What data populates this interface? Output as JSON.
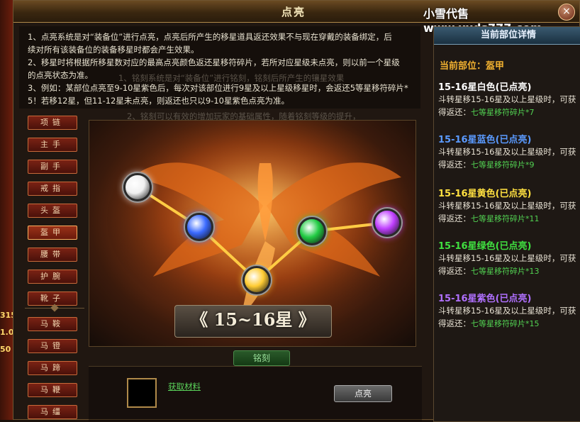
{
  "window": {
    "title": "点亮",
    "watermark": "小雪代售www.xxds777.com",
    "close_glyph": "×"
  },
  "sidebar_numbers": [
    "315",
    "1.00",
    "50"
  ],
  "description": [
    "1、点亮系统是对“装备位”进行点亮，点亮后所产生的移星道具返还效果不与现在穿戴的装备绑定，后",
    "续对所有该装备位的装备移星时都会产生效果。",
    "2、移星时将根据所移星数对应的最高点亮颜色返还星移符碎片，若所对应星级未点亮，则以前一个星级",
    "的点亮状态为准。",
    "3、例如：某部位点亮至9-10星紫色后，每次对该部位进行9星及以上星级移星时，会返还5等星移符碎片*",
    "5！若移12星，但11-12星未点亮，则返还也只以9-10星紫色点亮为准。"
  ],
  "ghost_text": [
    "1、铭刻系统是对“装备位”进行铭刻，铭刻后所产生的镶星效果",
    "2、铭刻可以有效的增加玩家的基础属性，随着铭刻等级的提升，"
  ],
  "slots": [
    "项链",
    "主手",
    "副手",
    "戒指",
    "头盔",
    "盔甲",
    "腰带",
    "护腕",
    "靴子",
    "马鞍",
    "马镫",
    "马蹄",
    "马鞭",
    "马缰"
  ],
  "active_slot_index": 5,
  "star_banner": "《 15~16星 》",
  "inscribe_button": "铭刻",
  "material_link": "获取材料",
  "light_button": "点亮",
  "right_panel": {
    "title": "当前部位详情",
    "current_part": "当前部位：盔甲",
    "tiers": [
      {
        "name": "15-16星白色(已点亮)",
        "color": "#ffffff",
        "line1": "斗转星移15-16星及以上星级时，可获",
        "line2": "得返还：",
        "reward": "七等星移符碎片*7"
      },
      {
        "name": "15-16星蓝色(已点亮)",
        "color": "#5a9aff",
        "line1": "斗转星移15-16星及以上星级时，可获",
        "line2": "得返还：",
        "reward": "七等星移符碎片*9"
      },
      {
        "name": "15-16星黄色(已点亮)",
        "color": "#ffe040",
        "line1": "斗转星移15-16星及以上星级时，可获",
        "line2": "得返还：",
        "reward": "七等星移符碎片*11"
      },
      {
        "name": "15-16星绿色(已点亮)",
        "color": "#40e040",
        "line1": "斗转星移15-16星及以上星级时，可获",
        "line2": "得返还：",
        "reward": "七等星移符碎片*13"
      },
      {
        "name": "15-16星紫色(已点亮)",
        "color": "#b070ff",
        "line1": "斗转星移15-16星及以上星级时，可获",
        "line2": "得返还：",
        "reward": "七等星移符碎片*15"
      }
    ]
  },
  "orbs": [
    {
      "name": "white-orb",
      "color": "#f0f0f0"
    },
    {
      "name": "blue-orb",
      "color": "#3a6aff"
    },
    {
      "name": "yellow-orb",
      "color": "#ffcc33"
    },
    {
      "name": "green-orb",
      "color": "#22cc44"
    },
    {
      "name": "purple-orb",
      "color": "#c040ff"
    }
  ]
}
